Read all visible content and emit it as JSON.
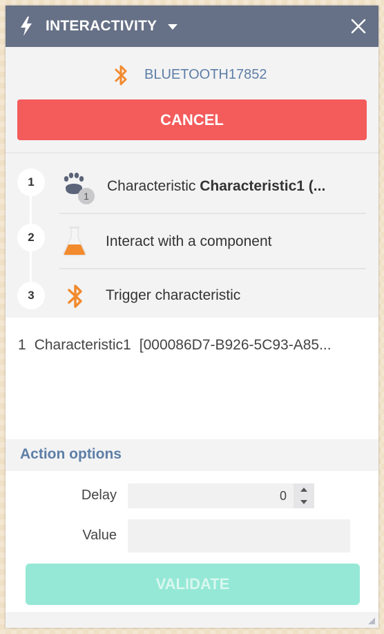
{
  "header": {
    "title": "INTERACTIVITY",
    "icon": "lightning-icon",
    "close_icon": "close-icon"
  },
  "device": {
    "icon": "bluetooth-icon",
    "name": "BLUETOOTH17852"
  },
  "cancel_label": "CANCEL",
  "steps": [
    {
      "number": "1",
      "icon": "paw-icon",
      "badge": "1",
      "text_prefix": "Characteristic ",
      "text_bold": "Characteristic1 (..."
    },
    {
      "number": "2",
      "icon": "flask-icon",
      "text": "Interact with a component"
    },
    {
      "number": "3",
      "icon": "bluetooth-icon",
      "text": "Trigger characteristic"
    }
  ],
  "content": {
    "index": "1",
    "name": "Characteristic1",
    "uuid": "[000086D7-B926-5C93-A85..."
  },
  "options": {
    "title": "Action options",
    "delay_label": "Delay",
    "delay_value": "0",
    "value_label": "Value",
    "value_value": ""
  },
  "validate_label": "VALIDATE",
  "colors": {
    "header_bg": "#667086",
    "cancel_bg": "#f45b5b",
    "validate_bg": "#95e8d6",
    "accent_orange": "#f28a2e",
    "accent_blue": "#5d7ea6"
  }
}
